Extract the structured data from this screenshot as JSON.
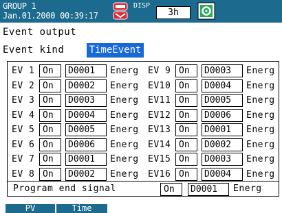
{
  "header": {
    "group": "GROUP 1",
    "datetime": "Jan.01.2000 00:39:17",
    "disp_label": "DISP",
    "disp_value": "3h",
    "alarm_icon": "alarm-memory-icon",
    "status_icon": "disk-status-icon",
    "accent_color": "#1c6b8e"
  },
  "screen": {
    "title": "Event output",
    "event_kind_label": "Event kind",
    "event_kind_value": "TimeEvent"
  },
  "events_left": [
    {
      "label": "EV 1",
      "state": "On",
      "code": "D0001",
      "action": "Energ"
    },
    {
      "label": "EV 2",
      "state": "On",
      "code": "D0002",
      "action": "Energ"
    },
    {
      "label": "EV 3",
      "state": "On",
      "code": "D0003",
      "action": "Energ"
    },
    {
      "label": "EV 4",
      "state": "On",
      "code": "D0004",
      "action": "Energ"
    },
    {
      "label": "EV 5",
      "state": "On",
      "code": "D0005",
      "action": "Energ"
    },
    {
      "label": "EV 6",
      "state": "On",
      "code": "D0006",
      "action": "Energ"
    },
    {
      "label": "EV 7",
      "state": "On",
      "code": "D0001",
      "action": "Energ"
    },
    {
      "label": "EV 8",
      "state": "On",
      "code": "D0002",
      "action": "Energ"
    }
  ],
  "events_right": [
    {
      "label": "EV 9",
      "state": "On",
      "code": "D0003",
      "action": "Energ"
    },
    {
      "label": "EV10",
      "state": "On",
      "code": "D0004",
      "action": "Energ"
    },
    {
      "label": "EV11",
      "state": "On",
      "code": "D0005",
      "action": "Energ"
    },
    {
      "label": "EV12",
      "state": "On",
      "code": "D0006",
      "action": "Energ"
    },
    {
      "label": "EV13",
      "state": "On",
      "code": "D0001",
      "action": "Energ"
    },
    {
      "label": "EV14",
      "state": "On",
      "code": "D0002",
      "action": "Energ"
    },
    {
      "label": "EV15",
      "state": "On",
      "code": "D0003",
      "action": "Energ"
    },
    {
      "label": "EV16",
      "state": "On",
      "code": "D0004",
      "action": "Energ"
    }
  ],
  "program_end": {
    "label": "Program end signal",
    "state": "On",
    "code": "D0001",
    "action": "Energ"
  },
  "softkeys": [
    "PV",
    "Time"
  ]
}
